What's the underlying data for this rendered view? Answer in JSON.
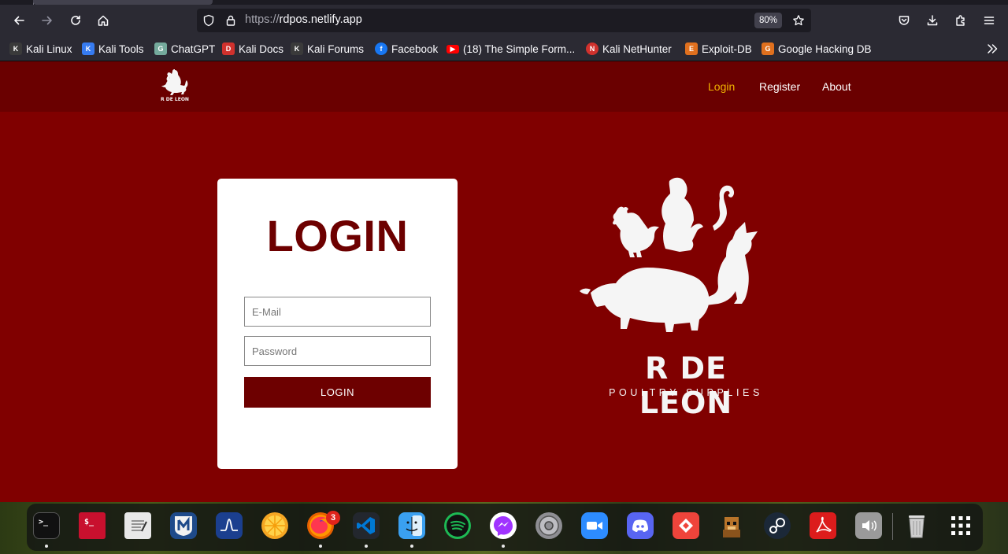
{
  "browser": {
    "url_scheme": "https://",
    "url_host": "rdpos.netlify.app",
    "zoom": "80%"
  },
  "bookmarks": [
    {
      "label": "Kali Linux",
      "icon": "kali-dragon-icon",
      "color": "#3a3a3a"
    },
    {
      "label": "Kali Tools",
      "icon": "kali-tools-icon",
      "color": "#367bf0"
    },
    {
      "label": "ChatGPT",
      "icon": "chatgpt-icon",
      "color": "#74aa9c"
    },
    {
      "label": "Kali Docs",
      "icon": "kali-docs-icon",
      "color": "#d0312d"
    },
    {
      "label": "Kali Forums",
      "icon": "kali-forums-icon",
      "color": "#3a3a3a"
    },
    {
      "label": "Facebook",
      "icon": "facebook-icon",
      "color": "#1877f2"
    },
    {
      "label": "(18) The Simple Form...",
      "icon": "youtube-icon",
      "color": "#ff0000"
    },
    {
      "label": "Kali NetHunter",
      "icon": "nethunter-icon",
      "color": "#d0312d"
    },
    {
      "label": "Exploit-DB",
      "icon": "exploit-db-icon",
      "color": "#e0701e"
    },
    {
      "label": "Google Hacking DB",
      "icon": "ghdb-icon",
      "color": "#e0701e"
    }
  ],
  "site": {
    "nav": {
      "login": "Login",
      "register": "Register",
      "about": "About"
    },
    "login": {
      "title": "LOGIN",
      "email_placeholder": "E-Mail",
      "password_placeholder": "Password",
      "button": "LOGIN"
    },
    "brand": {
      "name": "R DE LEON",
      "tagline": "POULTRY SUPPLIES",
      "logo_name": "R DE LEON"
    },
    "colors": {
      "page_bg": "#800000",
      "header_bg": "#6a0000",
      "accent": "#f0b400",
      "button": "#6d0000"
    }
  },
  "dock": {
    "apps": [
      {
        "name": "terminal",
        "glyph": ">_",
        "color": "#111111"
      },
      {
        "name": "root-terminal",
        "glyph": "$_",
        "color": "#c8102e"
      },
      {
        "name": "text-editor",
        "glyph": "",
        "color": "#e8e8e8"
      },
      {
        "name": "metasploit",
        "glyph": "M",
        "color": "#1e4a8a"
      },
      {
        "name": "wireshark",
        "glyph": "",
        "color": "#1b3f8f"
      },
      {
        "name": "citrus",
        "glyph": "",
        "color": "#f5a623"
      },
      {
        "name": "firefox",
        "glyph": "",
        "color": "#e66000",
        "badge": "3"
      },
      {
        "name": "vscode",
        "glyph": "",
        "color": "#23272e"
      },
      {
        "name": "finder",
        "glyph": "",
        "color": "#3aa0f0"
      },
      {
        "name": "spotify",
        "glyph": "",
        "color": "#1db954"
      },
      {
        "name": "messenger",
        "glyph": "",
        "color": "#8f3cf5"
      },
      {
        "name": "settings",
        "glyph": "",
        "color": "#8e8e93"
      },
      {
        "name": "zoom",
        "glyph": "",
        "color": "#2d8cff"
      },
      {
        "name": "discord",
        "glyph": "",
        "color": "#5865f2"
      },
      {
        "name": "anydesk",
        "glyph": "",
        "color": "#ef443b"
      },
      {
        "name": "game",
        "glyph": "",
        "color": "#b8742a"
      },
      {
        "name": "steam",
        "glyph": "",
        "color": "#1b2838"
      },
      {
        "name": "acrobat",
        "glyph": "",
        "color": "#dc1c1c"
      },
      {
        "name": "volume",
        "glyph": "",
        "color": "#9a9a9a"
      },
      {
        "name": "trash",
        "glyph": "",
        "color": "#cfcfcf"
      },
      {
        "name": "app-grid",
        "glyph": "",
        "color": "transparent"
      }
    ]
  }
}
